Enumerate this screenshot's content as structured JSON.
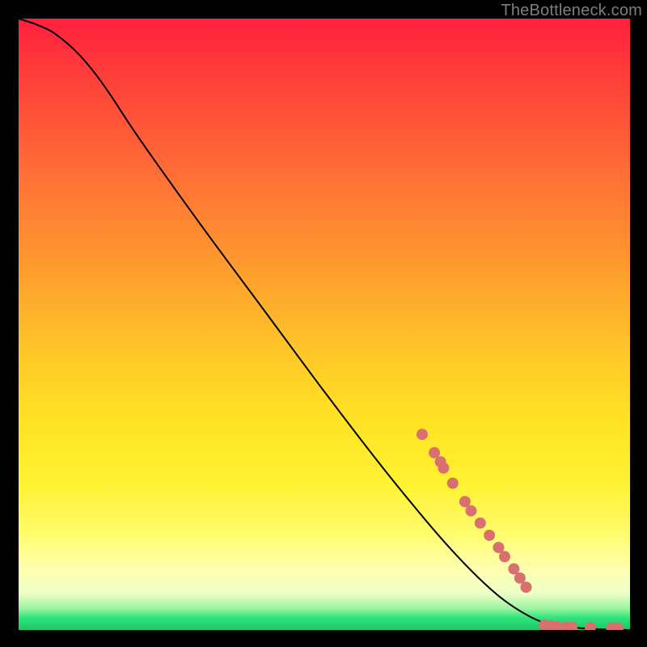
{
  "attribution": "TheBottleneck.com",
  "colors": {
    "marker_fill": "#d87070",
    "marker_stroke": "#b35858",
    "curve": "#000000",
    "frame": "#000000"
  },
  "chart_data": {
    "type": "line",
    "title": "",
    "xlabel": "",
    "ylabel": "",
    "xlim": [
      0,
      100
    ],
    "ylim": [
      0,
      100
    ],
    "grid": false,
    "legend": false,
    "curve": [
      {
        "x": 0,
        "y": 100
      },
      {
        "x": 3,
        "y": 99
      },
      {
        "x": 6,
        "y": 97.5
      },
      {
        "x": 10,
        "y": 94
      },
      {
        "x": 14,
        "y": 89
      },
      {
        "x": 20,
        "y": 80
      },
      {
        "x": 30,
        "y": 66
      },
      {
        "x": 40,
        "y": 52.5
      },
      {
        "x": 50,
        "y": 39
      },
      {
        "x": 60,
        "y": 26
      },
      {
        "x": 70,
        "y": 14
      },
      {
        "x": 78,
        "y": 6
      },
      {
        "x": 84,
        "y": 2
      },
      {
        "x": 88,
        "y": 0.8
      },
      {
        "x": 92,
        "y": 0.3
      },
      {
        "x": 96,
        "y": 0.1
      },
      {
        "x": 100,
        "y": 0
      }
    ],
    "markers": [
      {
        "x": 66,
        "y": 32
      },
      {
        "x": 68,
        "y": 29
      },
      {
        "x": 69,
        "y": 27.5
      },
      {
        "x": 69.5,
        "y": 26.5
      },
      {
        "x": 71,
        "y": 24
      },
      {
        "x": 73,
        "y": 21
      },
      {
        "x": 74,
        "y": 19.5
      },
      {
        "x": 75.5,
        "y": 17.5
      },
      {
        "x": 77,
        "y": 15.5
      },
      {
        "x": 78.5,
        "y": 13.5
      },
      {
        "x": 79.5,
        "y": 12
      },
      {
        "x": 81,
        "y": 10
      },
      {
        "x": 82,
        "y": 8.5
      },
      {
        "x": 83,
        "y": 7
      },
      {
        "x": 86,
        "y": 0.8
      },
      {
        "x": 87,
        "y": 0.7
      },
      {
        "x": 88,
        "y": 0.6
      },
      {
        "x": 89.5,
        "y": 0.5
      },
      {
        "x": 90.5,
        "y": 0.5
      },
      {
        "x": 93.5,
        "y": 0.4
      },
      {
        "x": 97,
        "y": 0.3
      },
      {
        "x": 98,
        "y": 0.3
      }
    ]
  }
}
